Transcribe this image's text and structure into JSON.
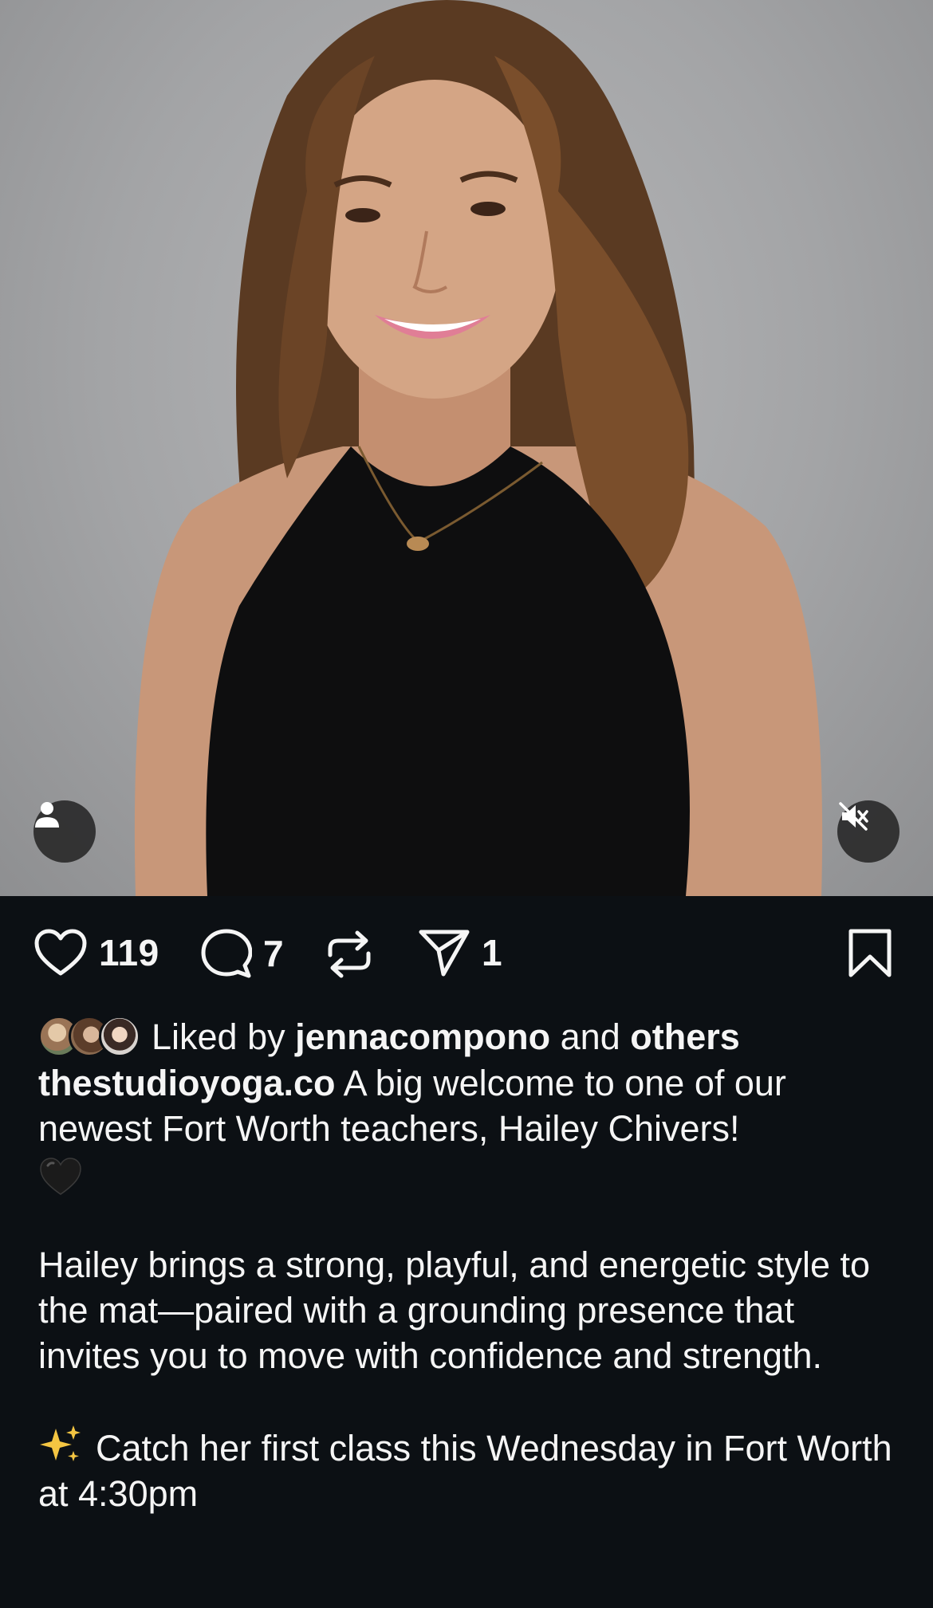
{
  "post": {
    "likes_count": "119",
    "comments_count": "7",
    "shares_count": "1"
  },
  "liked_by": {
    "prefix": "Liked by",
    "user": "jennacompono",
    "connector": "and",
    "others": "others"
  },
  "caption": {
    "author": "thestudioyoga.co",
    "line1": "A big welcome to one of our newest Fort Worth teachers, Hailey Chivers!",
    "para2": "Hailey brings a strong, playful, and energetic style to the mat—paired with a grounding presence that invites you to move with confidence and strength.",
    "para3": "Catch her first class this Wednesday in Fort Worth at 4:30pm"
  },
  "icons": {
    "tag": "person-icon",
    "mute": "speaker-muted-icon",
    "like": "heart-outline-icon",
    "comment": "comment-bubble-icon",
    "repost": "repost-arrows-icon",
    "share": "paper-plane-icon",
    "save": "bookmark-outline-icon",
    "heart_emoji": "black-heart-emoji",
    "sparkles_emoji": "sparkles-emoji"
  },
  "colors": {
    "background": "#0c1014",
    "text": "#f5f5f5",
    "sparkle": "#f4c542"
  }
}
